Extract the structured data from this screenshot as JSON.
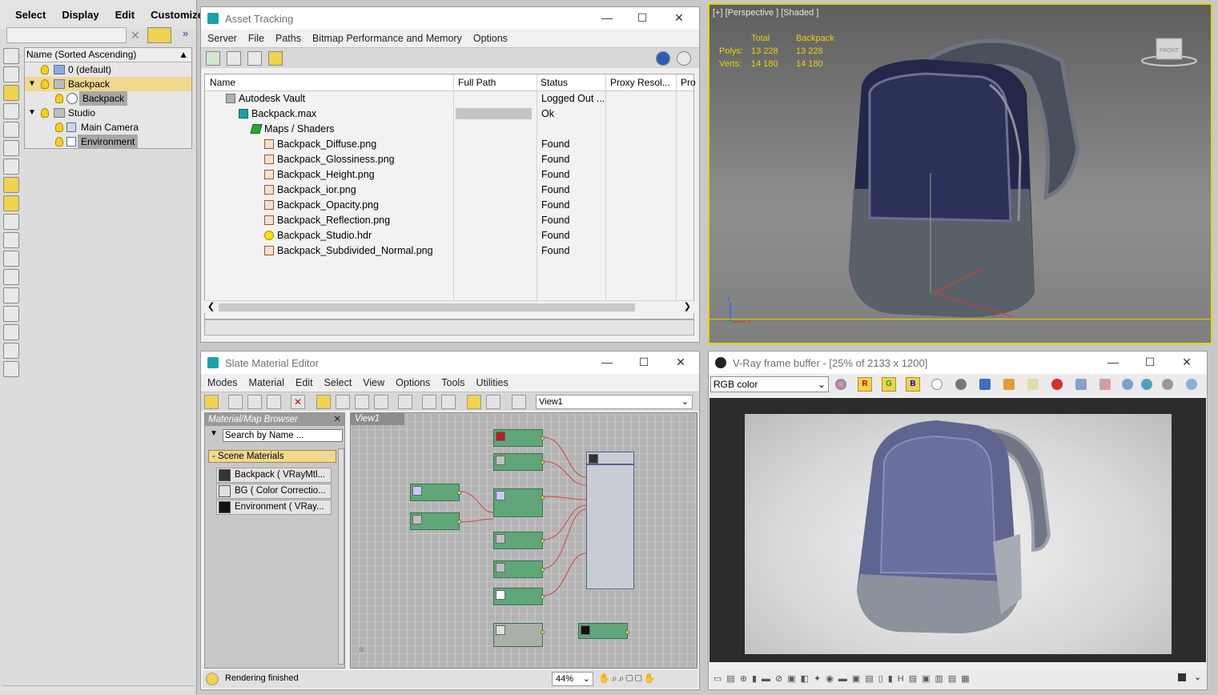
{
  "explorer": {
    "menu": [
      "Select",
      "Display",
      "Edit",
      "Customize"
    ],
    "more_icon": "double-chevron-right",
    "column_header": "Name (Sorted Ascending)",
    "rows": [
      {
        "label": "0 (default)",
        "type": "layer"
      },
      {
        "label": "Backpack",
        "type": "layer",
        "state": "selected-layer"
      },
      {
        "label": "Backpack",
        "type": "object",
        "state": "selected"
      },
      {
        "label": "Studio",
        "type": "layer"
      },
      {
        "label": "Main Camera",
        "type": "object"
      },
      {
        "label": "Environment",
        "type": "object",
        "state": "selected"
      }
    ]
  },
  "asset": {
    "title": "Asset Tracking",
    "menu": [
      "Server",
      "File",
      "Paths",
      "Bitmap Performance and Memory",
      "Options"
    ],
    "columns": [
      "Name",
      "Full Path",
      "Status",
      "Proxy Resol...",
      "Pro"
    ],
    "rows": [
      {
        "name": "Autodesk Vault",
        "status": "Logged Out ...",
        "icon": "vault",
        "indent": 0
      },
      {
        "name": "Backpack.max",
        "status": "Ok",
        "icon": "max",
        "indent": 1
      },
      {
        "name": "Maps / Shaders",
        "status": "",
        "icon": "green",
        "indent": 2
      },
      {
        "name": "Backpack_Diffuse.png",
        "status": "Found",
        "icon": "img",
        "indent": 3
      },
      {
        "name": "Backpack_Glossiness.png",
        "status": "Found",
        "icon": "img",
        "indent": 3
      },
      {
        "name": "Backpack_Height.png",
        "status": "Found",
        "icon": "img",
        "indent": 3
      },
      {
        "name": "Backpack_ior.png",
        "status": "Found",
        "icon": "img",
        "indent": 3
      },
      {
        "name": "Backpack_Opacity.png",
        "status": "Found",
        "icon": "img",
        "indent": 3
      },
      {
        "name": "Backpack_Reflection.png",
        "status": "Found",
        "icon": "img",
        "indent": 3
      },
      {
        "name": "Backpack_Studio.hdr",
        "status": "Found",
        "icon": "smile",
        "indent": 3
      },
      {
        "name": "Backpack_Subdivided_Normal.png",
        "status": "Found",
        "icon": "img",
        "indent": 3
      }
    ]
  },
  "viewport": {
    "label": "[+] [Perspective ] [Shaded ]",
    "stats": {
      "head_total": "Total",
      "head_obj": "Backpack",
      "polys_label": "Polys:",
      "polys_total": "13 228",
      "polys_obj": "13 228",
      "verts_label": "Verts:",
      "verts_total": "14 180",
      "verts_obj": "14 180"
    },
    "viewcube_label": "FRONT"
  },
  "slate": {
    "title": "Slate Material Editor",
    "menu": [
      "Modes",
      "Material",
      "Edit",
      "Select",
      "View",
      "Options",
      "Tools",
      "Utilities"
    ],
    "view_select": "View1",
    "browser_title": "Material/Map Browser",
    "search_placeholder": "Search by Name ...",
    "scene_materials": "- Scene Materials",
    "materials": [
      "Backpack  ( VRayMtl...",
      "BG  ( Color Correctio...",
      "Environment  ( VRay..."
    ],
    "view_tab": "View1",
    "status": "Rendering finished",
    "zoom": "44%"
  },
  "vfb": {
    "title": "V-Ray frame buffer - [25% of 2133 x 1200]",
    "channel": "RGB color",
    "channel_buttons": [
      "R",
      "G",
      "B"
    ]
  },
  "colors": {
    "accent_yellow": "#e6d300",
    "node_green": "#5fa779",
    "wire_red": "#e04040"
  }
}
